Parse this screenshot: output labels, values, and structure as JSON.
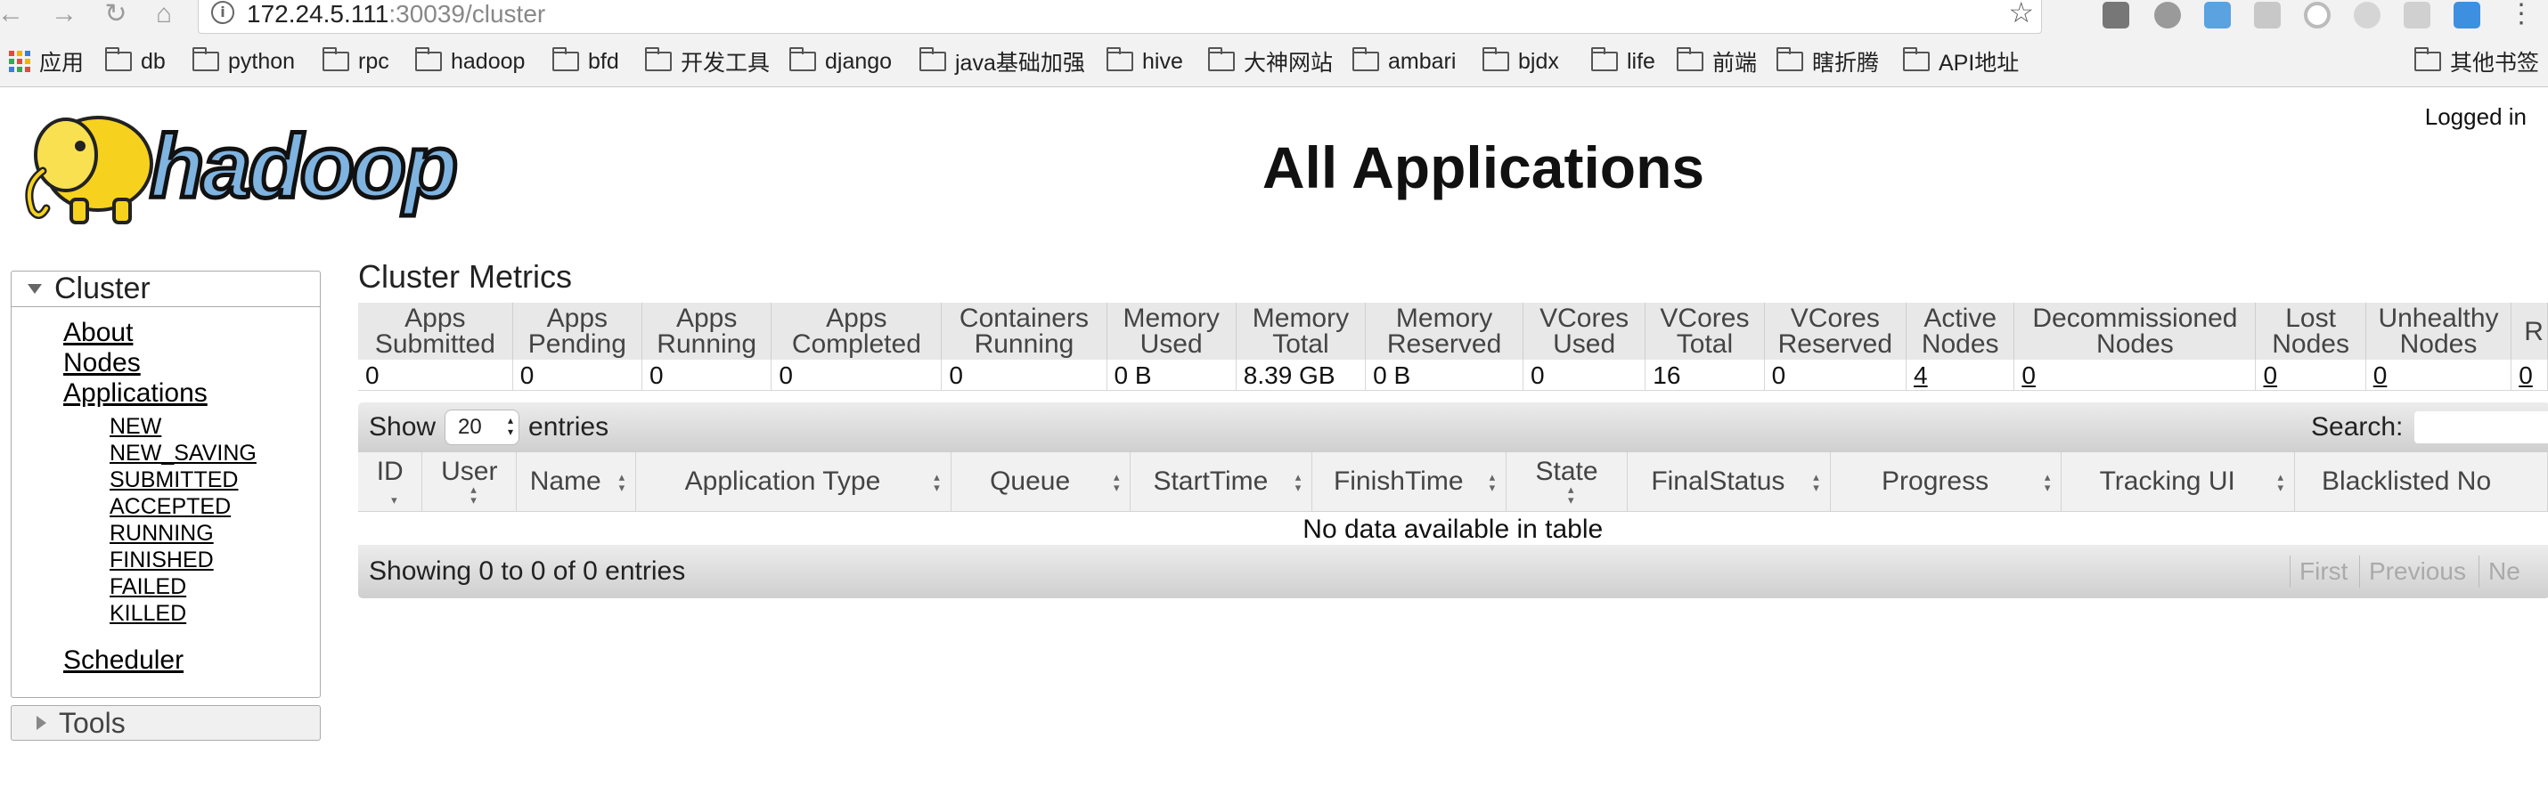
{
  "browser": {
    "url_host": "172.24.5.111",
    "url_path": ":30039/cluster",
    "bookmarks": [
      "应用",
      "db",
      "python",
      "rpc",
      "hadoop",
      "bfd",
      "开发工具",
      "django",
      "java基础加强",
      "hive",
      "大神网站",
      "ambari",
      "bjdx",
      "life",
      "前端",
      "瞎折腾",
      "API地址"
    ],
    "other_bookmarks": "其他书签"
  },
  "header": {
    "logo_text": "hadoop",
    "title": "All Applications",
    "logged_in": "Logged in"
  },
  "sidebar": {
    "cluster_label": "Cluster",
    "links": [
      "About",
      "Nodes",
      "Applications"
    ],
    "app_states": [
      "NEW",
      "NEW_SAVING",
      "SUBMITTED",
      "ACCEPTED",
      "RUNNING",
      "FINISHED",
      "FAILED",
      "KILLED"
    ],
    "scheduler": "Scheduler",
    "tools_label": "Tools"
  },
  "metrics": {
    "title": "Cluster Metrics",
    "headers": [
      "Apps Submitted",
      "Apps Pending",
      "Apps Running",
      "Apps Completed",
      "Containers Running",
      "Memory Used",
      "Memory Total",
      "Memory Reserved",
      "VCores Used",
      "VCores Total",
      "VCores Reserved",
      "Active Nodes",
      "Decommissioned Nodes",
      "Lost Nodes",
      "Unhealthy Nodes",
      "R"
    ],
    "values": [
      "0",
      "0",
      "0",
      "0",
      "0",
      "0 B",
      "8.39 GB",
      "0 B",
      "0",
      "16",
      "0",
      "4",
      "0",
      "0",
      "0",
      "0"
    ]
  },
  "apps_table": {
    "show_label": "Show",
    "page_size": "20",
    "entries_label": "entries",
    "search_label": "Search:",
    "columns": [
      "ID",
      "User",
      "Name",
      "Application Type",
      "Queue",
      "StartTime",
      "FinishTime",
      "State",
      "FinalStatus",
      "Progress",
      "Tracking UI",
      "Blacklisted No"
    ],
    "empty_message": "No data available in table",
    "info": "Showing 0 to 0 of 0 entries",
    "pagination": [
      "First",
      "Previous",
      "Ne"
    ]
  }
}
